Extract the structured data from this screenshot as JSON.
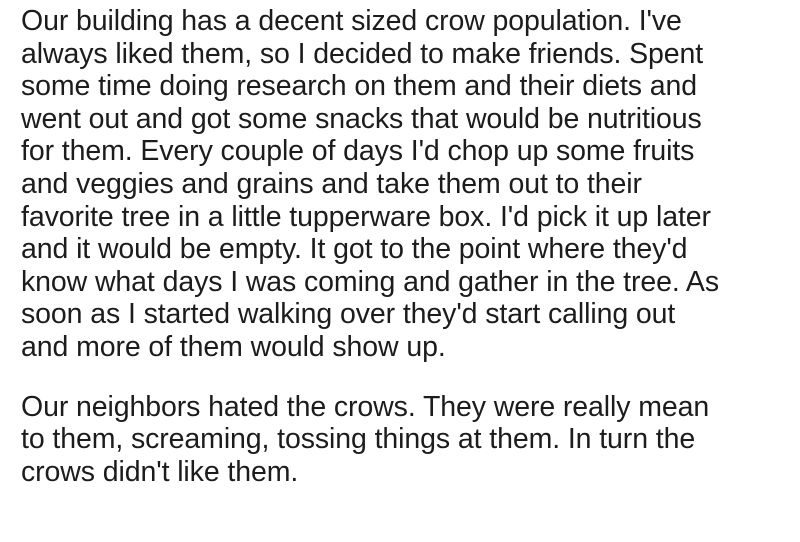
{
  "post": {
    "paragraphs": [
      {
        "lines": [
          "Our building has a decent sized crow population. I've",
          "always liked them, so I decided to make friends. Spent",
          "some time doing research on them and their diets and",
          "went out and got some snacks that would be nutritious",
          "for them. Every couple of days I'd chop up some fruits",
          "and veggies and grains and take them out to their",
          "favorite tree in a little tupperware box. I'd pick it up later",
          "and it would be empty. It got to the point where they'd",
          "know what days I was coming and gather in the tree. As",
          "soon as I started walking over they'd start calling out",
          "and more of them would show up."
        ]
      },
      {
        "lines": [
          "Our neighbors hated the crows. They were really mean",
          "to them, screaming, tossing things at them. In turn the",
          "crows didn't like them."
        ]
      }
    ]
  }
}
